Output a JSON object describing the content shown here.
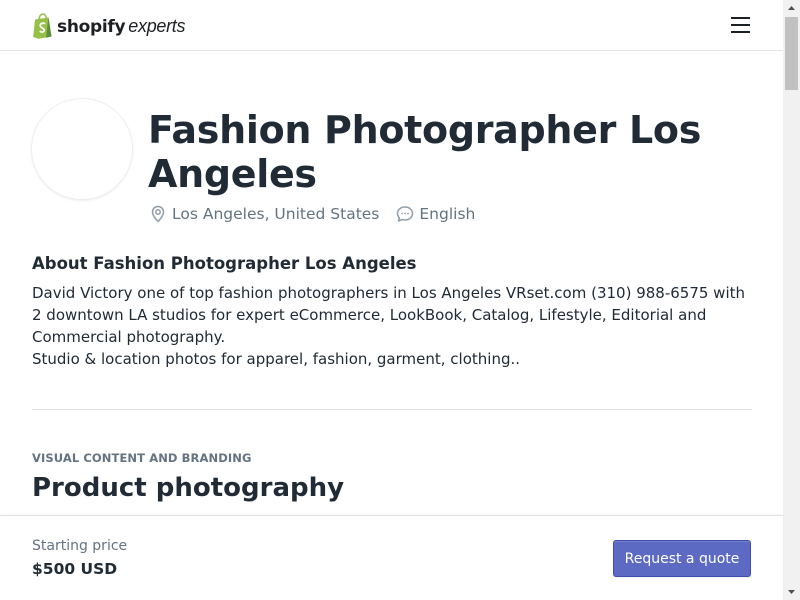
{
  "header": {
    "logo_brand": "shopify",
    "logo_sub": "experts",
    "menu_icon": "hamburger-menu-icon",
    "brand_color": "#95bf47"
  },
  "profile": {
    "name": "Fashion Photographer Los Angeles",
    "location": "Los Angeles, United States",
    "location_icon": "map-pin-icon",
    "language": "English",
    "language_icon": "chat-bubble-icon"
  },
  "about": {
    "heading": "About Fashion Photographer Los Angeles",
    "paragraph_1": "David Victory one of top fashion photographers in Los Angeles VRset.com (310) 988-6575 with 2 downtown LA studios for expert eCommerce, LookBook, Catalog, Lifestyle, Editorial and Commercial photography.",
    "paragraph_2": "Studio & location photos for apparel, fashion, garment, clothing.."
  },
  "service": {
    "category": "VISUAL CONTENT AND BRANDING",
    "title": "Product photography"
  },
  "footer": {
    "price_label": "Starting price",
    "price_value": "$500 USD",
    "quote_button": "Request a quote",
    "accent_color": "#5c6ac4"
  }
}
